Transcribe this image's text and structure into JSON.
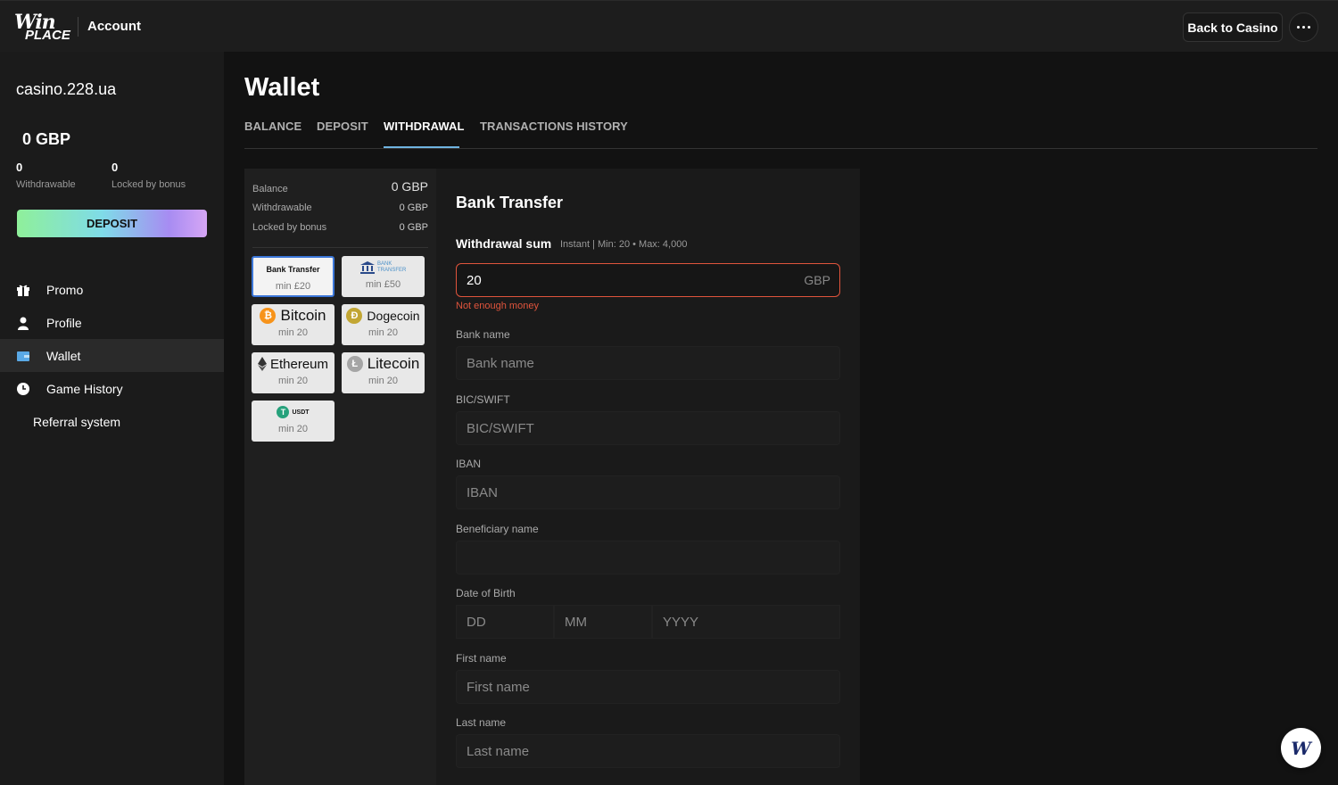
{
  "header": {
    "logo_top": "Win",
    "logo_bottom": "PLACE",
    "title": "Account",
    "back_label": "Back to Casino"
  },
  "sidebar": {
    "site": "casino.228.ua",
    "balance": "0 GBP",
    "withdrawable_value": "0",
    "withdrawable_label": "Withdrawable",
    "locked_value": "0",
    "locked_label": "Locked by bonus",
    "deposit_label": "DEPOSIT",
    "items": [
      {
        "label": "Promo",
        "icon": "gift-icon"
      },
      {
        "label": "Profile",
        "icon": "user-icon"
      },
      {
        "label": "Wallet",
        "icon": "wallet-icon"
      },
      {
        "label": "Game History",
        "icon": "clock-icon"
      },
      {
        "label": "Referral system",
        "icon": ""
      }
    ]
  },
  "main": {
    "title": "Wallet",
    "tabs": [
      "BALANCE",
      "DEPOSIT",
      "WITHDRAWAL",
      "TRANSACTIONS HISTORY"
    ],
    "active_tab": "WITHDRAWAL"
  },
  "panel_balance": {
    "balance_label": "Balance",
    "balance_value": "0 GBP",
    "withdrawable_label": "Withdrawable",
    "withdrawable_value": "0 GBP",
    "locked_label": "Locked by bonus",
    "locked_value": "0 GBP"
  },
  "methods": [
    {
      "name": "Bank Transfer",
      "min": "min £20",
      "selected": true
    },
    {
      "name": "BANK TRANSFER",
      "min": "min £50",
      "selected": false
    },
    {
      "name": "Bitcoin",
      "min": "min 20",
      "coin": "₿",
      "color": "#f7931a"
    },
    {
      "name": "Dogecoin",
      "min": "min 20",
      "coin": "Ð",
      "color": "#c2a633"
    },
    {
      "name": "Ethereum",
      "min": "min 20",
      "coin": "◆",
      "color": "#333333"
    },
    {
      "name": "Litecoin",
      "min": "min 20",
      "coin": "Ł",
      "color": "#a5a5a5"
    },
    {
      "name": "USDT",
      "min": "min 20",
      "coin": "T",
      "color": "#26a17b"
    }
  ],
  "form": {
    "title": "Bank Transfer",
    "sum_label": "Withdrawal sum",
    "sum_hint": "Instant | Min: 20 • Max: 4,000",
    "amount": "20",
    "currency": "GBP",
    "error": "Not enough money",
    "fields": {
      "bank_name_label": "Bank name",
      "bank_name_placeholder": "Bank name",
      "bic_label": "BIC/SWIFT",
      "bic_placeholder": "BIC/SWIFT",
      "iban_label": "IBAN",
      "iban_placeholder": "IBAN",
      "beneficiary_label": "Beneficiary name",
      "beneficiary_placeholder": "",
      "dob_label": "Date of Birth",
      "dob_dd": "DD",
      "dob_mm": "MM",
      "dob_yyyy": "YYYY",
      "first_label": "First name",
      "first_placeholder": "First name",
      "last_label": "Last name",
      "last_placeholder": "Last name"
    }
  },
  "colors": {
    "accent": "#6fb3e0",
    "error": "#e0543c",
    "selected_border": "#3b76d8"
  }
}
